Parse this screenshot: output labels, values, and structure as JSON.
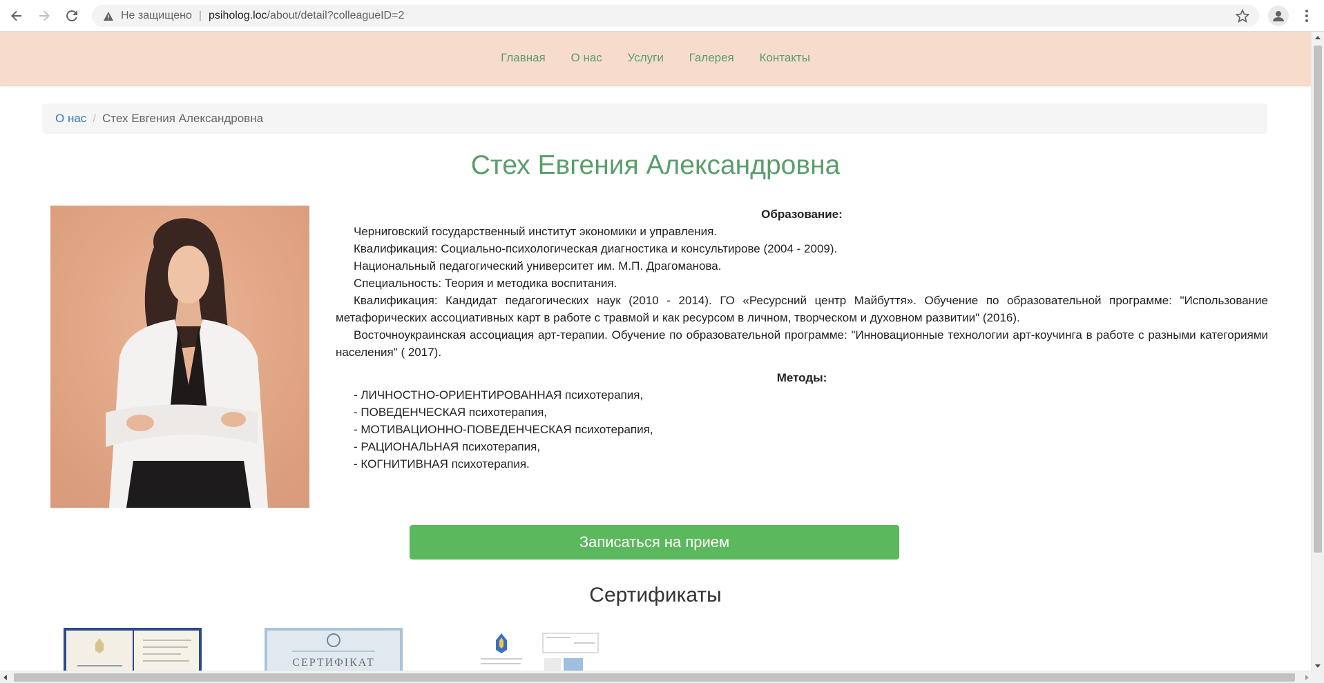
{
  "browser": {
    "security_label": "Не защищено",
    "url_host": "psiholog.loc",
    "url_path": "/about/detail?colleagueID=2"
  },
  "nav": {
    "items": [
      "Главная",
      "О нас",
      "Услуги",
      "Галерея",
      "Контакты"
    ]
  },
  "breadcrumb": {
    "parent": "О нас",
    "current": "Стех Евгения Александровна"
  },
  "profile": {
    "name": "Стех Евгения Александровна",
    "education_title": "Образование:",
    "education": [
      "Черниговский государственный институт экономики и управления.",
      "Квалификация: Социально-психологическая диагностика и консультирове (2004 - 2009).",
      "Национальный педагогический университет им. М.П. Драгоманова.",
      "Специальность: Теория и методика воспитания.",
      "Квалификация: Кандидат педагогических наук (2010 - 2014). ГО «Ресурсний центр Майбуття». Обучение по образовательной программе: \"Использование метафорических ассоциативных карт в работе с травмой и как ресурсом в личном, творческом и духовном развитии\" (2016).",
      "Восточноукраинская ассоциация арт-терапии. Обучение по образовательной программе: \"Инновационные технологии арт-коучинга в работе с разными категориями населения\" ( 2017)."
    ],
    "methods_title": "Методы:",
    "methods": [
      "- ЛИЧНОСТНО-ОРИЕНТИРОВАННАЯ психотерапия,",
      "- ПОВЕДЕНЧЕСКАЯ психотерапия,",
      "- МОТИВАЦИОННО-ПОВЕДЕНЧЕСКАЯ психотерапия,",
      "- РАЦИОНАЛЬНАЯ психотерапия,",
      "- КОГНИТИВНАЯ психотерапия."
    ]
  },
  "cta": {
    "label": "Записаться на прием"
  },
  "certificates": {
    "title": "Сертификаты",
    "cert2_text": "СЕРТИФІКАТ"
  },
  "colors": {
    "header_bg": "#f7dccb",
    "link_green": "#5a9e6b",
    "button_green": "#5cb85c",
    "breadcrumb_link": "#337ab7"
  }
}
